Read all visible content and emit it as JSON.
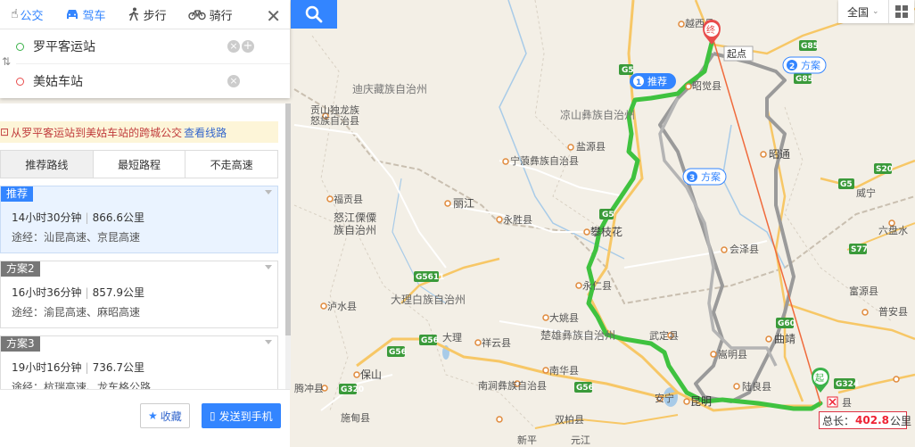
{
  "modes": {
    "bus": "公交",
    "drive": "驾车",
    "walk": "步行",
    "ride": "骑行"
  },
  "route": {
    "from": "罗平客运站",
    "to": "美姑车站"
  },
  "notice": {
    "text": "从罗平客运站到美姑车站的跨城公交",
    "link": "查看线路"
  },
  "tabs": [
    "推荐路线",
    "最短路程",
    "不走高速"
  ],
  "plans": [
    {
      "badge": "推荐",
      "time": "14小时30分钟",
      "distance": "866.6公里",
      "via": "途经：汕昆高速、京昆高速"
    },
    {
      "badge": "方案2",
      "time": "16小时36分钟",
      "distance": "857.9公里",
      "via": "途经：渝昆高速、麻昭高速"
    },
    {
      "badge": "方案3",
      "time": "19小时16分钟",
      "distance": "736.7公里",
      "via": "途经：杭瑞高速、龙车格公路"
    }
  ],
  "actions": {
    "favorite": "收藏",
    "send": "发送到手机"
  },
  "topright": {
    "region": "全国"
  },
  "distance_box": {
    "prefix": "总长：",
    "value": "402.8",
    "unit": "公里"
  },
  "markers": {
    "end": "终",
    "start": "起",
    "end_label": "起点",
    "recommend": "推荐",
    "plan2": "方案",
    "plan3": "方案"
  },
  "map_labels": {
    "yuexi": "越西县",
    "zhaojue": "昭觉县",
    "liangshan": "凉山彝族自治州",
    "diqing": "迪庆藏族自治州",
    "gongshan": "贡山独龙族",
    "gongshan2": "怒族自治县",
    "yanyuan": "盐源县",
    "ninglang": "宁蒗彝族自治县",
    "lijiang": "丽江",
    "yongsheng": "永胜县",
    "panzhihua": "攀枝花",
    "fugong": "福贡县",
    "nujiang1": "怒江傈僳",
    "nujiang2": "族自治州",
    "huize": "会泽县",
    "yongren": "永仁县",
    "dali": "大理白族自治州",
    "luquan1": "泸水县",
    "dayao": "大姚县",
    "chuxiong": "楚雄彝族自治州",
    "wuding": "武定县",
    "xiangyun": "祥云县",
    "dali_c": "大理",
    "baoshan": "保山",
    "nanhua": "南华县",
    "songming": "嵩明县",
    "qujing": "曲靖",
    "zhaotong": "昭通",
    "luliang": "陆良县",
    "kunming": "昆明",
    "anning": "安宁",
    "tengchong": "腾冲县",
    "nanjian": "南涧彝族自治县",
    "shidian": "施甸县",
    "shuangbai": "双柏县",
    "liupanshui": "六盘水",
    "fuyuan": "富源县",
    "puan": "普安县",
    "weining": "威宁",
    "xinping": "新平",
    "yuanjiang": "元江",
    "luoping_c": "县"
  },
  "road_shields": [
    "G5",
    "G85",
    "G85",
    "S20",
    "G5",
    "S77",
    "G5611",
    "G56",
    "G56",
    "G60",
    "G56",
    "G320",
    "G324",
    "G5"
  ]
}
